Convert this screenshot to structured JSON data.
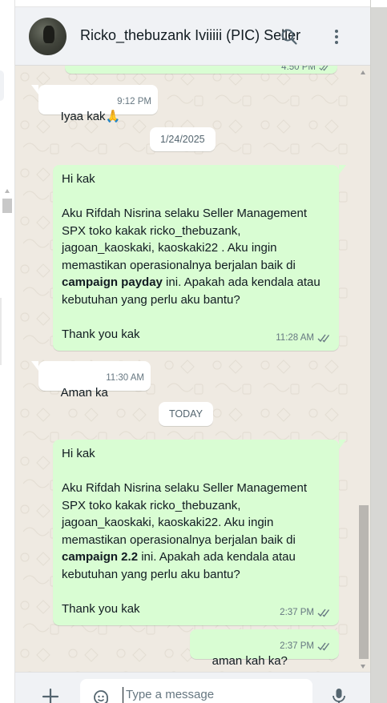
{
  "header": {
    "title": "Ricko_thebuzank Iviiiii (PIC) Seller",
    "avatar_icon": "contact-avatar-photo",
    "search_icon": "search-icon",
    "menu_icon": "kebab-menu-icon"
  },
  "messages": [
    {
      "direction": "out",
      "text": "",
      "time": "4:50 PM",
      "status": "read",
      "partial": true
    },
    {
      "direction": "in",
      "text": "Iyaa kak🙏",
      "time": "9:12 PM"
    },
    {
      "type": "date",
      "label": "1/24/2025"
    },
    {
      "direction": "out",
      "line1": "Hi kak",
      "line2": "Aku Rifdah Nisrina selaku Seller Management SPX toko kakak  ricko_thebuzank, jagoan_kaoskaki, kaoskaki22 . Aku ingin memastikan operasionalnya berjalan baik di ",
      "bold": "campaign payday",
      "line3": " ini. Apakah ada kendala atau kebutuhan yang perlu aku bantu?",
      "line4": "Thank you kak",
      "time": "11:28 AM",
      "status": "read"
    },
    {
      "direction": "in",
      "text": "Aman ka",
      "time": "11:30 AM"
    },
    {
      "type": "date",
      "label": "TODAY"
    },
    {
      "direction": "out",
      "line1": "Hi kak",
      "line2": "Aku Rifdah Nisrina selaku Seller Management SPX toko kakak   ricko_thebuzank, jagoan_kaoskaki, kaoskaki22. Aku ingin memastikan operasionalnya berjalan baik di ",
      "bold": "campaign 2.2",
      "line3": " ini. Apakah ada kendala atau kebutuhan yang perlu aku bantu?",
      "line4": "Thank you kak",
      "time": "2:37 PM",
      "status": "read"
    },
    {
      "direction": "out",
      "text": "aman kah ka?",
      "time": "2:37 PM",
      "status": "read"
    }
  ],
  "composer": {
    "placeholder": "Type a message",
    "value": "",
    "plus_icon": "plus-icon",
    "sticker_icon": "sticker-icon",
    "mic_icon": "microphone-icon"
  },
  "colors": {
    "header_bg": "#f0f2f5",
    "chat_bg": "#efeae2",
    "outgoing_bubble": "#d9fdd3",
    "incoming_bubble": "#ffffff",
    "read_tick": "#667781",
    "meta_text": "#667781"
  }
}
